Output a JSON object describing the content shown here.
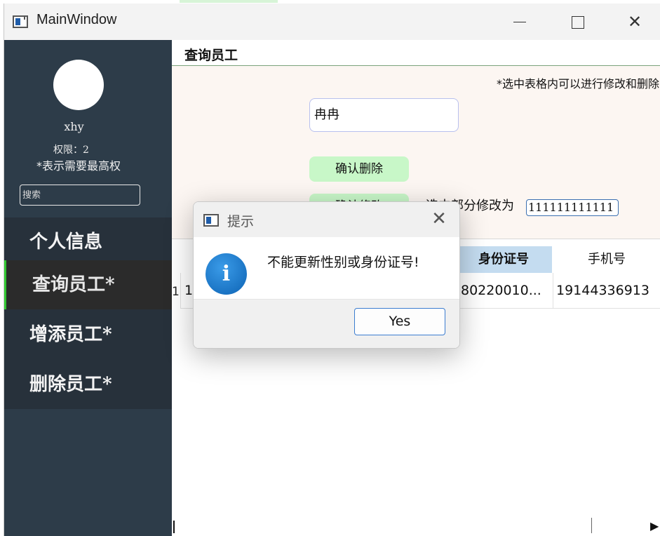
{
  "window": {
    "title": "MainWindow",
    "close_glyph": "✕"
  },
  "sidebar": {
    "username": "xhy",
    "permission": "权限：2",
    "hint": "*表示需要最高权",
    "search_placeholder": "搜索",
    "items": [
      {
        "label": "个人信息"
      },
      {
        "label": "查询员工*"
      },
      {
        "label": "增添员工*"
      },
      {
        "label": "删除员工*"
      }
    ],
    "active_index": 1,
    "accent_color": "#32c832"
  },
  "main": {
    "page_title": "查询员工",
    "note": "*选中表格内可以进行修改和删除",
    "name_input_value": "冉冉",
    "delete_button": "确认删除",
    "modify_button": "确认修改",
    "modify_label": "选中部分修改为",
    "modify_input_value": "111111111111"
  },
  "table": {
    "row_number": "1",
    "headers": {
      "id_number": "身份证号",
      "phone": "手机号"
    },
    "rows": [
      {
        "first": "12",
        "id_number": "80220010...",
        "phone": "19144336913"
      }
    ]
  },
  "dialog": {
    "title": "提示",
    "icon": "info-icon",
    "icon_glyph": "i",
    "message": "不能更新性别或身份证号!",
    "yes_button": "Yes",
    "close_glyph": "✕"
  }
}
